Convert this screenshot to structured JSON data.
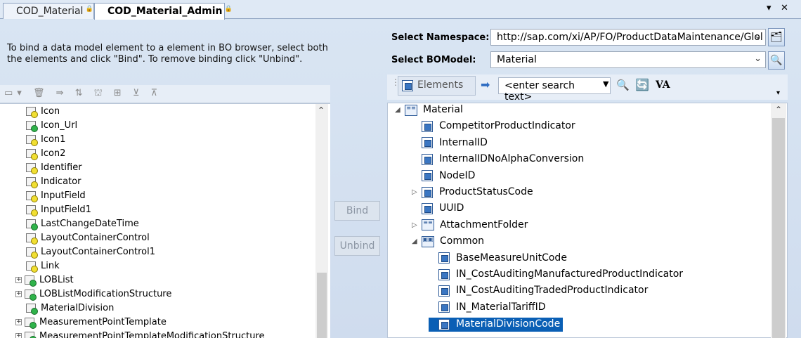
{
  "tabs": [
    {
      "label": "COD_Material",
      "active": false
    },
    {
      "label": "COD_Material_Admin",
      "active": true
    }
  ],
  "window_controls": {
    "dropdown": "▾",
    "close": "✕"
  },
  "instructions": "To bind a data model element to a element in BO browser, select both the elements and click \"Bind\". To remove binding click \"Unbind\".",
  "namespace": {
    "label": "Select Namespace:",
    "value": "http://sap.com/xi/AP/FO/ProductDataMaintenance/Glol"
  },
  "bomodel": {
    "label": "Select BOModel:",
    "value": "Material"
  },
  "buttons": {
    "bind": "Bind",
    "unbind": "Unbind"
  },
  "right_toolbar": {
    "elements_label": "Elements",
    "search_placeholder": "<enter search text>",
    "va_label": "VA"
  },
  "left_tree": [
    {
      "label": "Icon",
      "status": "yellow"
    },
    {
      "label": "Icon_Url",
      "status": "green"
    },
    {
      "label": "Icon1",
      "status": "yellow"
    },
    {
      "label": "Icon2",
      "status": "yellow"
    },
    {
      "label": "Identifier",
      "status": "yellow"
    },
    {
      "label": "Indicator",
      "status": "yellow"
    },
    {
      "label": "InputField",
      "status": "yellow"
    },
    {
      "label": "InputField1",
      "status": "yellow"
    },
    {
      "label": "LastChangeDateTime",
      "status": "green"
    },
    {
      "label": "LayoutContainerControl",
      "status": "yellow"
    },
    {
      "label": "LayoutContainerControl1",
      "status": "yellow"
    },
    {
      "label": "Link",
      "status": "yellow"
    },
    {
      "label": "LOBList",
      "status": "green",
      "expandable": true
    },
    {
      "label": "LOBListModificationStructure",
      "status": "green",
      "expandable": true
    },
    {
      "label": "MaterialDivision",
      "status": "green"
    },
    {
      "label": "MeasurementPointTemplate",
      "status": "green",
      "expandable": true
    },
    {
      "label": "MeasurementPointTemplateModificationStructure",
      "status": "green",
      "expandable": true
    }
  ],
  "right_tree": [
    {
      "label": "Material",
      "level": 0,
      "icon": "list",
      "expander": "open"
    },
    {
      "label": "CompetitorProductIndicator",
      "level": 1,
      "icon": "element"
    },
    {
      "label": "InternalID",
      "level": 1,
      "icon": "element"
    },
    {
      "label": "InternalIDNoAlphaConversion",
      "level": 1,
      "icon": "element"
    },
    {
      "label": "NodeID",
      "level": 1,
      "icon": "element"
    },
    {
      "label": "ProductStatusCode",
      "level": 1,
      "icon": "element",
      "expander": "closed"
    },
    {
      "label": "UUID",
      "level": 1,
      "icon": "element"
    },
    {
      "label": "AttachmentFolder",
      "level": 1,
      "icon": "list",
      "expander": "closed"
    },
    {
      "label": "Common",
      "level": 1,
      "icon": "group",
      "expander": "open"
    },
    {
      "label": "BaseMeasureUnitCode",
      "level": 2,
      "icon": "element"
    },
    {
      "label": "IN_CostAuditingManufacturedProductIndicator",
      "level": 2,
      "icon": "element"
    },
    {
      "label": "IN_CostAuditingTradedProductIndicator",
      "level": 2,
      "icon": "element"
    },
    {
      "label": "IN_MaterialTariffID",
      "level": 2,
      "icon": "element"
    },
    {
      "label": "MaterialDivisionCode",
      "level": 2,
      "icon": "element",
      "selected": true
    }
  ]
}
